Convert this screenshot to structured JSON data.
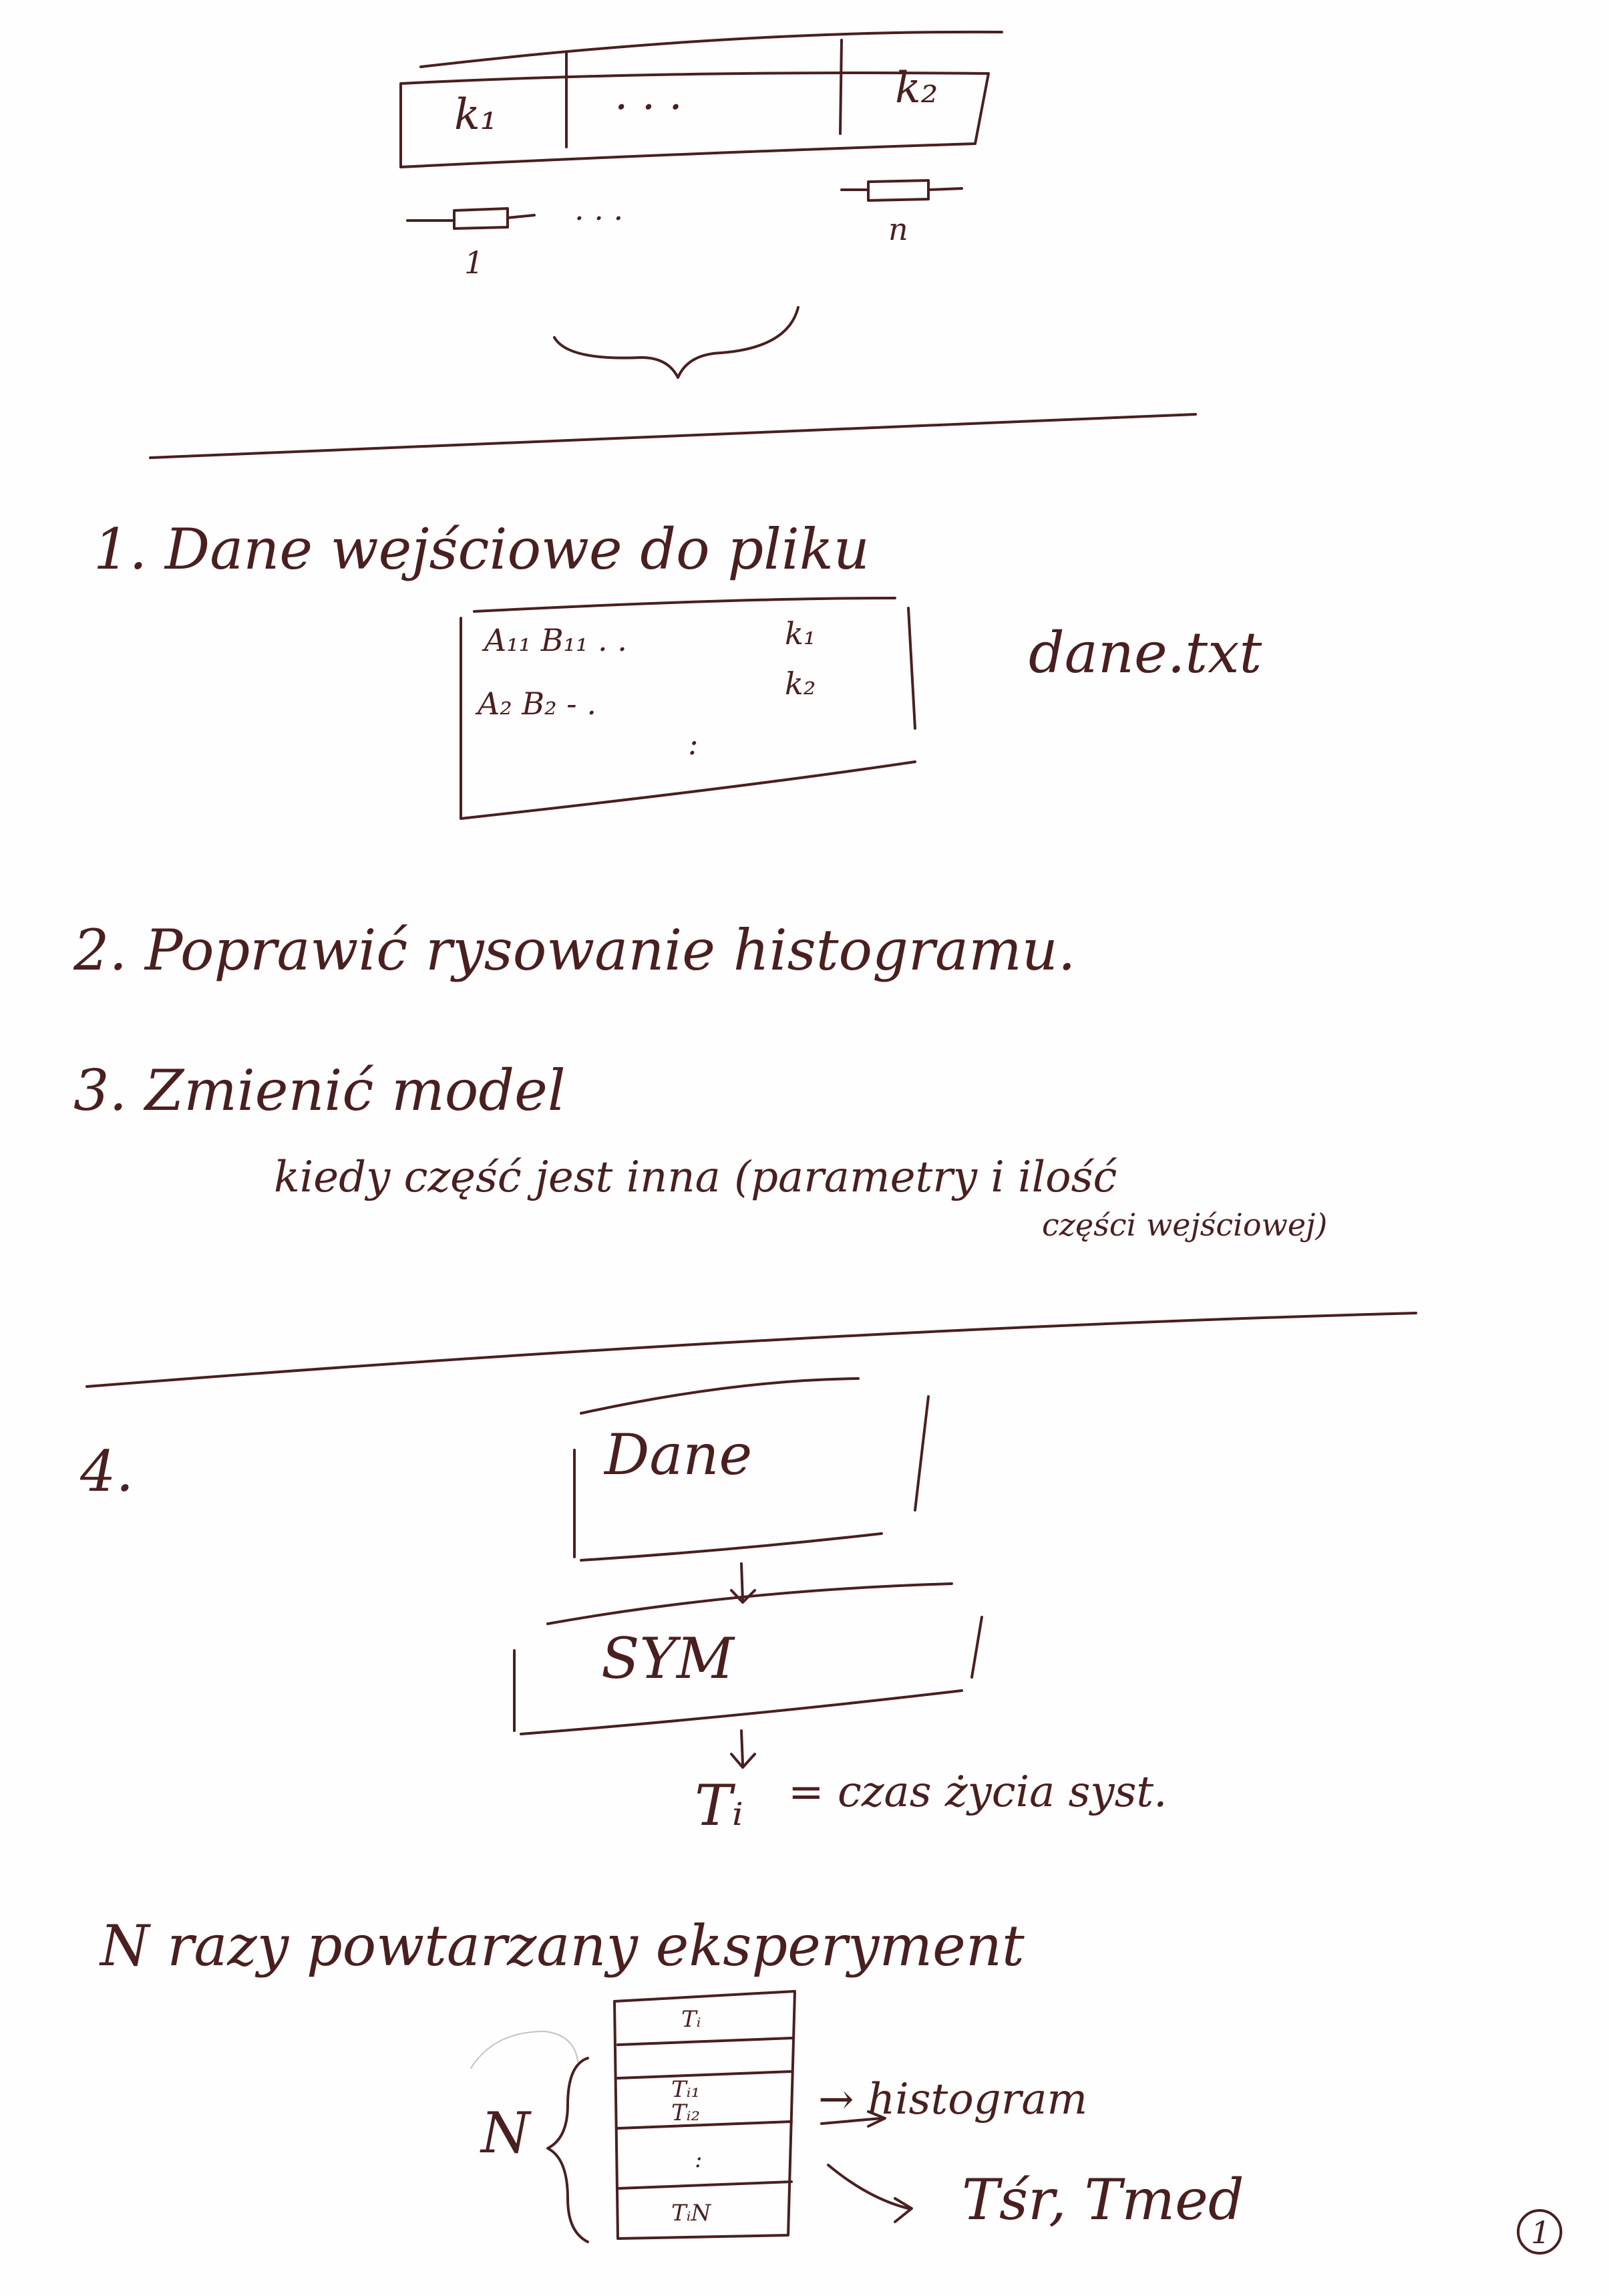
{
  "top_sketch": {
    "cell_first": "k₁",
    "cell_dots": ". . .",
    "cell_last": "k₂",
    "resistor_dots": ". . .",
    "label_first": "1",
    "label_last": "n"
  },
  "item1": {
    "text": "1. Dane wejściowe do pliku",
    "table_row1": "A₁₁ B₁₁ . .",
    "table_row2": "A₂ B₂ - .",
    "table_dots": ":",
    "table_k1": "k₁",
    "table_k2": "k₂",
    "filename": "dane.txt"
  },
  "item2": {
    "text": "2. Poprawić rysowanie histogramu."
  },
  "item3": {
    "text": "3. Zmienić model",
    "line2": "kiedy część jest inna (parametry i ilość",
    "line3": "części wejściowej)"
  },
  "item4": {
    "number": "4.",
    "box_data": "Dane",
    "box_sym": "SYM",
    "ti_label": "Tᵢ",
    "ti_desc": "= czas życia syst.",
    "repeat_text": "N razy powtarzany eksperyment",
    "col_header": "Tᵢ",
    "col_rows": [
      "Tᵢ₁",
      "Tᵢ₂",
      ":",
      "TᵢN"
    ],
    "n_label": "N",
    "histogram": "→ histogram",
    "stats": "Tśr, Tmed"
  },
  "page_number": "1",
  "colors": {
    "ink": "#4a1f1f",
    "paper": "#fefefe"
  }
}
